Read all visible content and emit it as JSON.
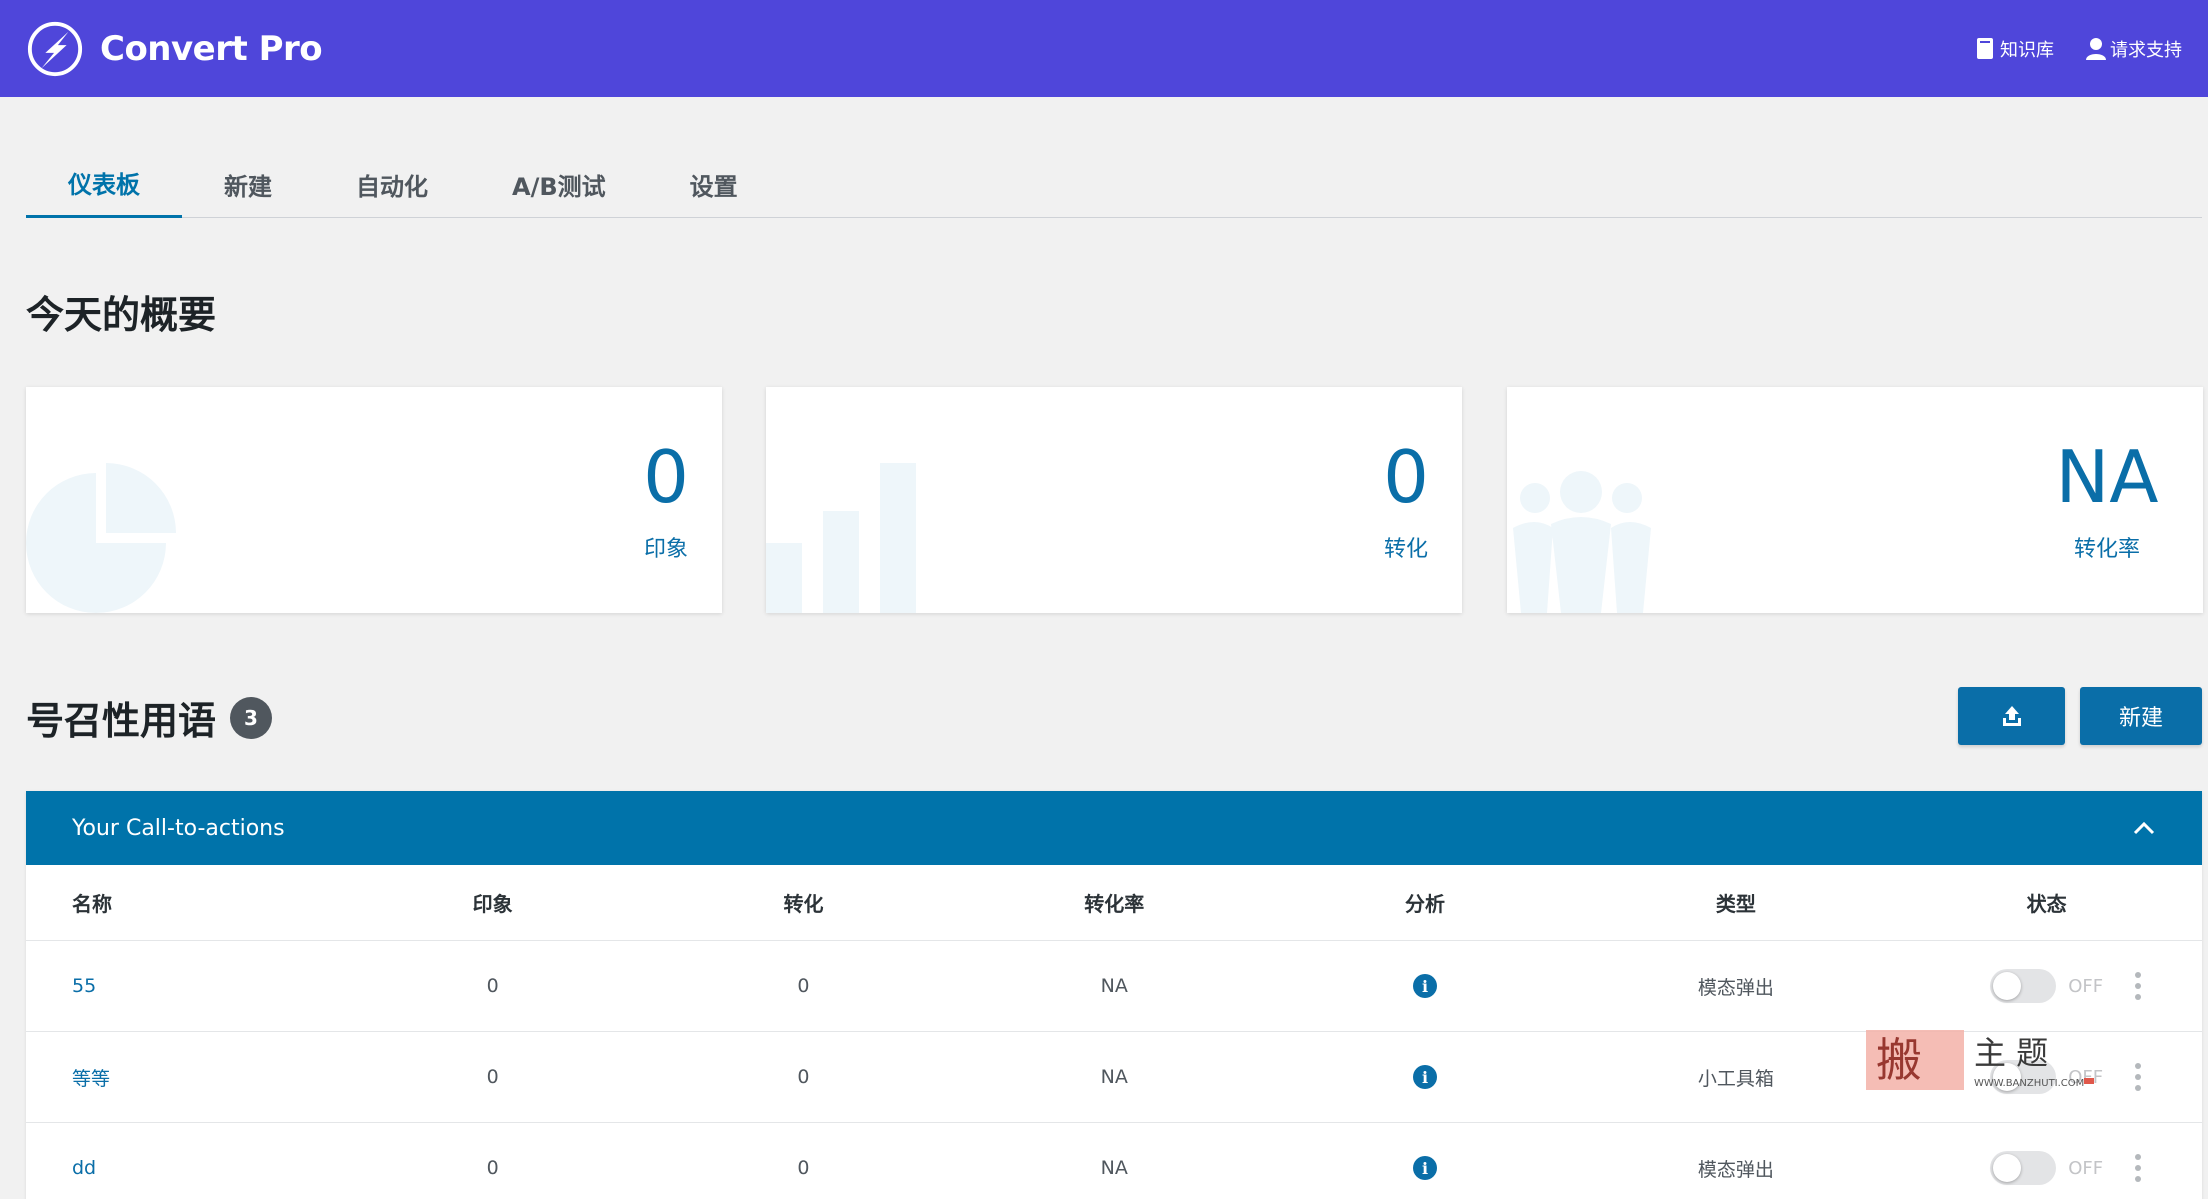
{
  "app": {
    "title": "Convert Pro"
  },
  "header": {
    "kb_label": "知识库",
    "support_label": "请求支持"
  },
  "tabs": [
    {
      "label": "仪表板",
      "active": true
    },
    {
      "label": "新建",
      "active": false
    },
    {
      "label": "自动化",
      "active": false
    },
    {
      "label": "A/B测试",
      "active": false
    },
    {
      "label": "设置",
      "active": false
    }
  ],
  "summary": {
    "title": "今天的概要",
    "cards": [
      {
        "value": "0",
        "label": "印象",
        "icon": "pie-chart-icon"
      },
      {
        "value": "0",
        "label": "转化",
        "icon": "bar-chart-icon"
      },
      {
        "value": "NA",
        "label": "转化率",
        "icon": "users-icon"
      }
    ]
  },
  "cta": {
    "title": "号召性用语",
    "count": "3",
    "new_button": "新建",
    "export_icon": "upload-icon",
    "panel_title": "Your Call-to-actions",
    "columns": [
      "名称",
      "印象",
      "转化",
      "转化率",
      "分析",
      "类型",
      "状态"
    ],
    "rows": [
      {
        "name": "55",
        "impressions": "0",
        "conversions": "0",
        "rate": "NA",
        "type": "模态弹出",
        "status": "OFF"
      },
      {
        "name": "等等",
        "impressions": "0",
        "conversions": "0",
        "rate": "NA",
        "type": "小工具箱",
        "status": "OFF"
      },
      {
        "name": "dd",
        "impressions": "0",
        "conversions": "0",
        "rate": "NA",
        "type": "模态弹出",
        "status": "OFF"
      }
    ]
  },
  "watermark": {
    "text": "搬主题",
    "url": "WWW.BANZHUTI.COM"
  },
  "colors": {
    "header": "#4f46da",
    "accent": "#0073aa",
    "value": "#0a6ea8"
  }
}
